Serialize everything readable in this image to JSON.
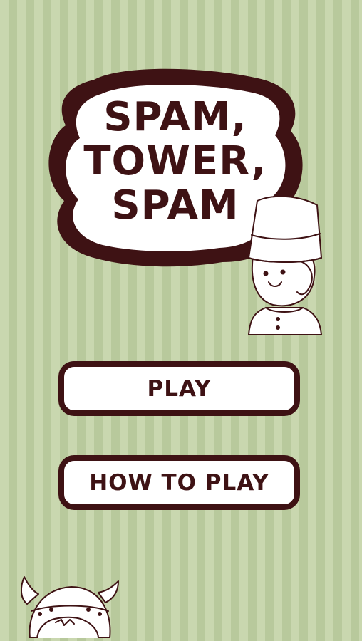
{
  "title": {
    "lines": [
      "SPAM,",
      "TOWER,",
      "SPAM"
    ]
  },
  "menu": {
    "play_label": "PLAY",
    "how_to_play_label": "HOW TO PLAY"
  },
  "colors": {
    "background": "#c7d5ad",
    "stripe": "#b8c99c",
    "outline": "#3e1214",
    "button_fill": "#ffffff"
  },
  "icons": {
    "guard_character": "guard-mascot-icon",
    "viking_character": "viking-mascot-icon"
  }
}
